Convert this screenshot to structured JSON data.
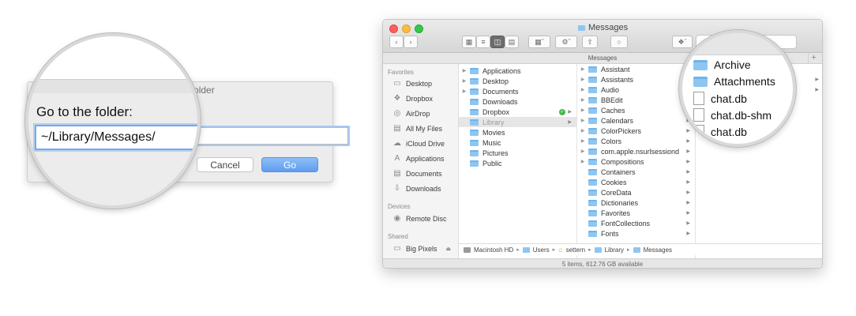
{
  "go_to_folder": {
    "title": "Go to Folder",
    "label": "Go to the folder:",
    "path_value": "~/Library/Messages/",
    "cancel_label": "Cancel",
    "go_label": "Go"
  },
  "finder": {
    "window_title": "Messages",
    "path_header": "Messages",
    "sidebar": {
      "favorites_header": "Favorites",
      "favorites": [
        {
          "label": "Desktop",
          "icon": "desktop-icon"
        },
        {
          "label": "Dropbox",
          "icon": "dropbox-icon"
        },
        {
          "label": "AirDrop",
          "icon": "airdrop-icon"
        },
        {
          "label": "All My Files",
          "icon": "all-files-icon"
        },
        {
          "label": "iCloud Drive",
          "icon": "cloud-icon"
        },
        {
          "label": "Applications",
          "icon": "applications-icon"
        },
        {
          "label": "Documents",
          "icon": "documents-icon"
        },
        {
          "label": "Downloads",
          "icon": "downloads-icon"
        }
      ],
      "devices_header": "Devices",
      "devices": [
        {
          "label": "Remote Disc",
          "icon": "disc-icon"
        }
      ],
      "shared_header": "Shared",
      "shared": [
        {
          "label": "Big Pixels",
          "icon": "monitor-icon"
        }
      ]
    },
    "column1": [
      "Applications",
      "Desktop",
      "Documents",
      "Downloads",
      "Dropbox",
      "Library",
      "Movies",
      "Music",
      "Pictures",
      "Public"
    ],
    "column2": [
      "Assistant",
      "Assistants",
      "Audio",
      "BBEdit",
      "Caches",
      "Calendars",
      "ColorPickers",
      "Colors",
      "com.apple.nsurlsessiond",
      "Compositions",
      "Containers",
      "Cookies",
      "CoreData",
      "Dictionaries",
      "Favorites",
      "FontCollections",
      "Fonts"
    ],
    "column3_zoom": [
      "Archive",
      "Attachments",
      "chat.db",
      "chat.db-shm",
      "chat.db"
    ],
    "path_bar": [
      "Macintosh HD",
      "Users",
      "settern",
      "Library",
      "Messages"
    ],
    "status": "5 items, 612.76 GB available"
  }
}
